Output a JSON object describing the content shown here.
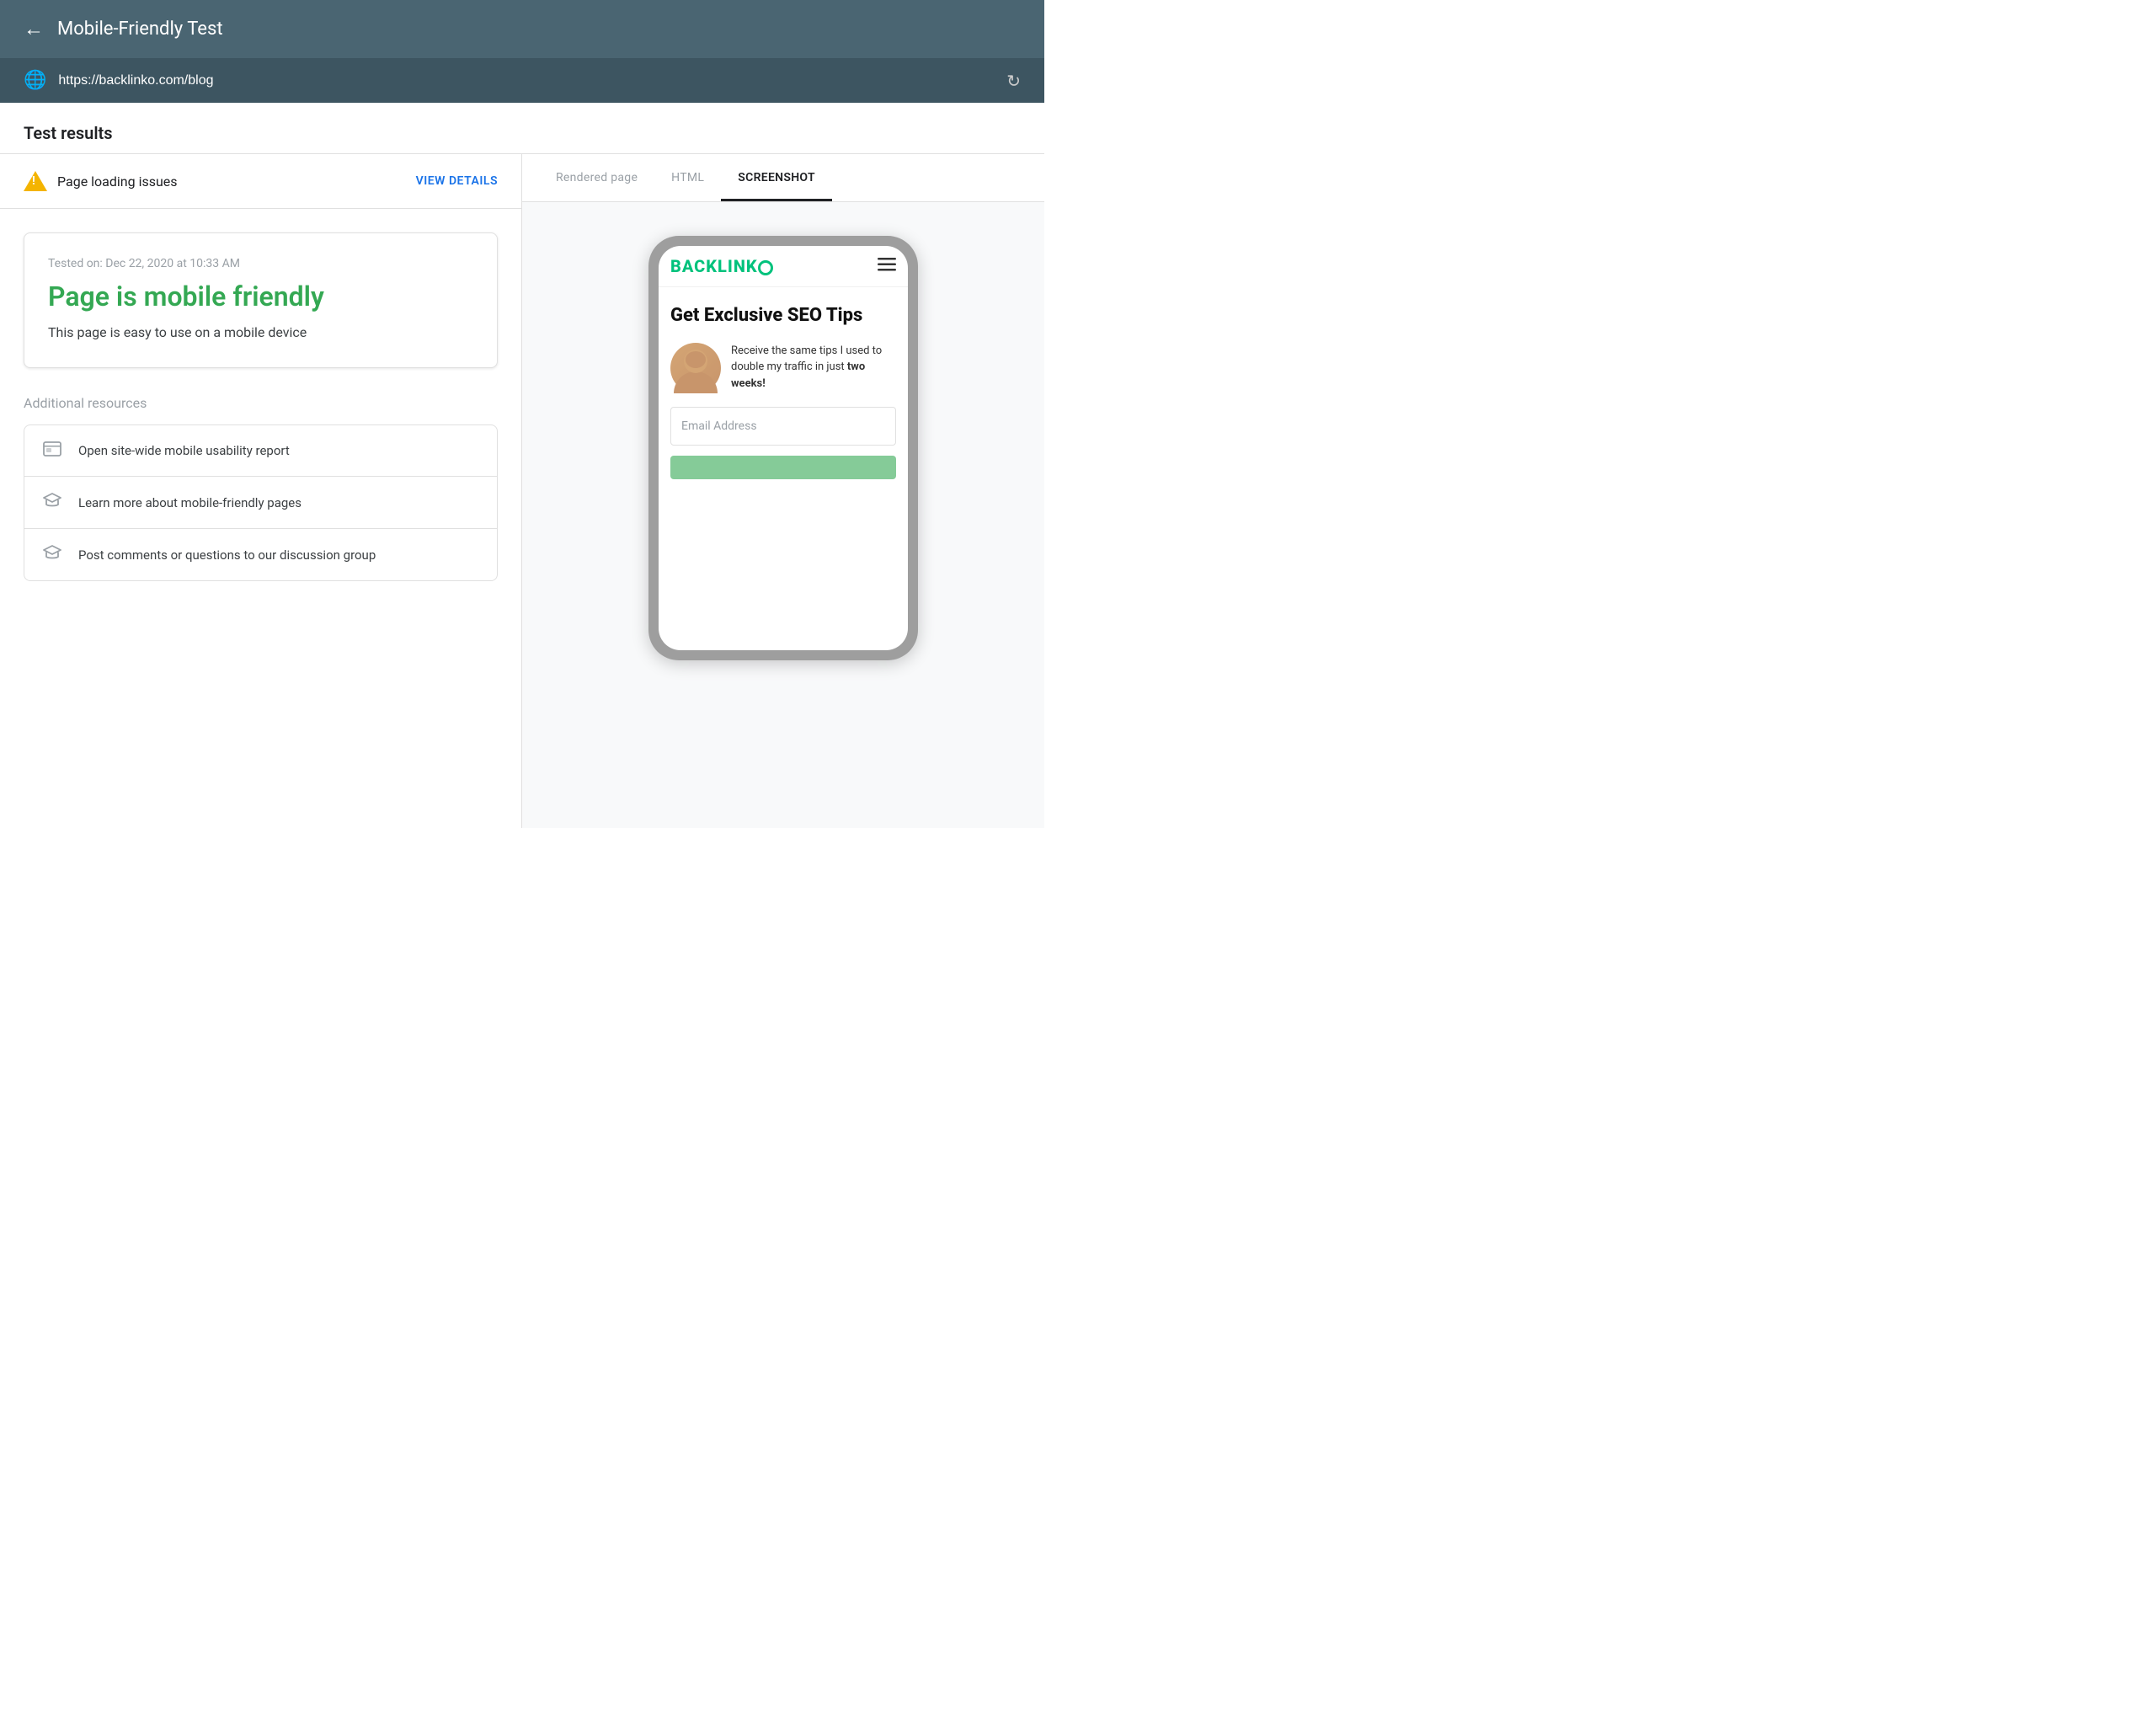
{
  "header": {
    "back_icon": "←",
    "title": "Mobile-Friendly Test"
  },
  "url_bar": {
    "globe_icon": "🌐",
    "url": "https://backlinko.com/blog",
    "refresh_icon": "↻"
  },
  "test_results": {
    "section_title": "Test results"
  },
  "issues_bar": {
    "issues_text": "Page loading issues",
    "view_details_label": "VIEW DETAILS"
  },
  "tabs": {
    "rendered_page": "Rendered page",
    "html": "HTML",
    "screenshot": "SCREENSHOT"
  },
  "result_card": {
    "tested_on": "Tested on: Dec 22, 2020 at 10:33 AM",
    "mobile_friendly_title": "Page is mobile friendly",
    "mobile_friendly_desc": "This page is easy to use on a mobile device"
  },
  "additional_resources": {
    "section_title": "Additional resources",
    "items": [
      {
        "icon": "▤",
        "text": "Open site-wide mobile usability report"
      },
      {
        "icon": "🎓",
        "text": "Learn more about mobile-friendly pages"
      },
      {
        "icon": "🎓",
        "text": "Post comments or questions to our discussion group"
      }
    ]
  },
  "phone_mockup": {
    "logo_text": "BACKLINKO",
    "logo_o_style": "circle",
    "headline": "Get Exclusive SEO Tips",
    "offer_text_1": "Receive the same tips I used to double my traffic in just ",
    "offer_text_bold": "two weeks!",
    "email_placeholder": "Email Address"
  },
  "colors": {
    "header_bg": "#4a6572",
    "url_bar_bg": "#3d5561",
    "green": "#34a853",
    "backlinko_green": "#00c27c",
    "warning_yellow": "#f4b400",
    "link_blue": "#1a73e8"
  }
}
